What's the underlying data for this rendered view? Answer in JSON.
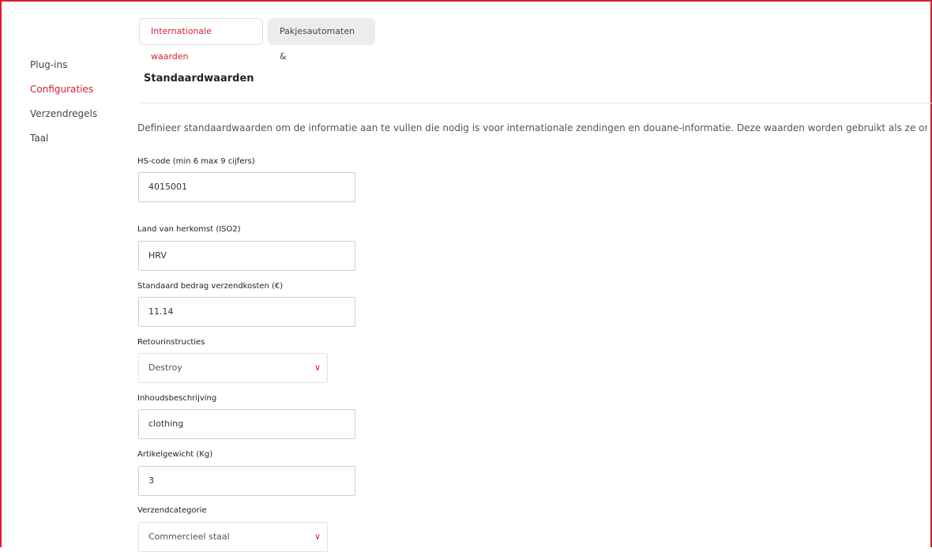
{
  "tabs": [
    {
      "label": "Internationale waarden"
    },
    {
      "label": "Pakjesautomaten &"
    }
  ],
  "sidebar": {
    "items": [
      {
        "label": "Plug-ins"
      },
      {
        "label": "Configuraties"
      },
      {
        "label": "Verzendregels"
      },
      {
        "label": "Taal"
      }
    ]
  },
  "section": {
    "title": "Standaardwaarden",
    "description": "Definieer standaardwaarden om de informatie aan te vullen die nodig is voor internationale zendingen en douane-informatie. Deze waarden worden gebruikt als ze ontbreken in je"
  },
  "fields": {
    "hs_code": {
      "label": "HS-code (min 6 max 9 cijfers)",
      "value": "4015001"
    },
    "origin_country": {
      "label": "Land van herkomst (ISO2)",
      "value": "HRV"
    },
    "shipping_cost": {
      "label": "Standaard bedrag verzendkosten (€)",
      "value": "11.14"
    },
    "return_instructions": {
      "label": "Retourinstructies",
      "value": "Destroy"
    },
    "content_description": {
      "label": "Inhoudsbeschrijving",
      "value": "clothing"
    },
    "item_weight": {
      "label": "Artikelgewicht (Kg)",
      "value": "3"
    },
    "shipping_category": {
      "label": "Verzendcategorie",
      "value": "Commercieel staal"
    }
  },
  "colors": {
    "accent": "#d4202f"
  },
  "icons": {
    "select_arrow": "chevron-down-icon"
  }
}
